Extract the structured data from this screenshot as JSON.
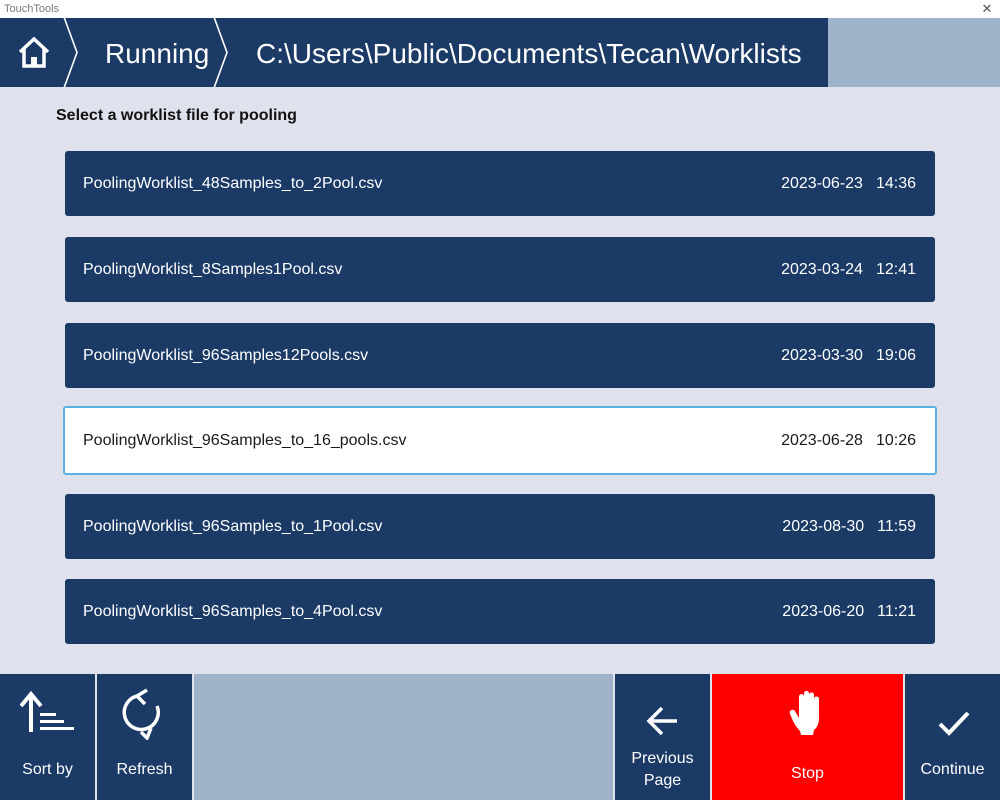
{
  "window": {
    "title": "TouchTools",
    "close_glyph": "✕"
  },
  "breadcrumb": {
    "home_icon": "home-icon",
    "items": [
      {
        "label": "Running"
      },
      {
        "label": "C:\\Users\\Public\\Documents\\Tecan\\Worklists"
      }
    ]
  },
  "main": {
    "heading": "Select a worklist file for pooling",
    "files": [
      {
        "name": "PoolingWorklist_48Samples_to_2Pool.csv",
        "date": "2023-06-23",
        "time": "14:36",
        "selected": false
      },
      {
        "name": "PoolingWorklist_8Samples1Pool.csv",
        "date": "2023-03-24",
        "time": "12:41",
        "selected": false
      },
      {
        "name": "PoolingWorklist_96Samples12Pools.csv",
        "date": "2023-03-30",
        "time": "19:06",
        "selected": false
      },
      {
        "name": "PoolingWorklist_96Samples_to_16_pools.csv",
        "date": "2023-06-28",
        "time": "10:26",
        "selected": true
      },
      {
        "name": "PoolingWorklist_96Samples_to_1Pool.csv",
        "date": "2023-08-30",
        "time": "11:59",
        "selected": false
      },
      {
        "name": "PoolingWorklist_96Samples_to_4Pool.csv",
        "date": "2023-06-20",
        "time": "11:21",
        "selected": false
      }
    ]
  },
  "toolbar": {
    "sort_label": "Sort by",
    "refresh_label": "Refresh",
    "previous_label_line1": "Previous",
    "previous_label_line2": "Page",
    "stop_label": "Stop",
    "continue_label": "Continue"
  },
  "colors": {
    "navy": "#1b3a66",
    "slate": "#9fb3ca",
    "background": "#dfe2ed",
    "stop_red": "#fe0000",
    "selected_border": "#5ab0e0"
  }
}
